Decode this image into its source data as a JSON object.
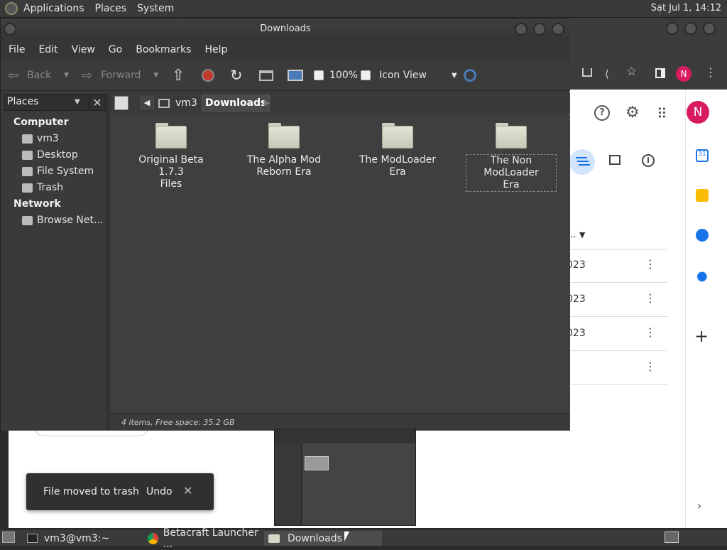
{
  "top_panel": {
    "menus": [
      "Applications",
      "Places",
      "System"
    ],
    "clock": "Sat Jul 1, 14:12"
  },
  "browser": {
    "profile_letter": "N",
    "list_rows": [
      "...",
      "023",
      "023",
      "023"
    ],
    "accent": "#1a73e8"
  },
  "window": {
    "title": "Downloads",
    "menu": [
      "File",
      "Edit",
      "View",
      "Go",
      "Bookmarks",
      "Help"
    ],
    "toolbar": {
      "back": "Back",
      "forward": "Forward",
      "zoom": "100%",
      "view_mode": "Icon View"
    },
    "sidebar": {
      "selector": "Places",
      "heading_computer": "Computer",
      "items_computer": [
        "vm3",
        "Desktop",
        "File System",
        "Trash"
      ],
      "heading_network": "Network",
      "items_network": [
        "Browse Net..."
      ]
    },
    "path": {
      "home": "vm3",
      "current": "Downloads"
    },
    "folders": [
      {
        "line1": "Original Beta 1.7.3",
        "line2": "Files"
      },
      {
        "line1": "The Alpha Mod",
        "line2": "Reborn Era"
      },
      {
        "line1": "The ModLoader Era",
        "line2": ""
      },
      {
        "line1": "The Non ModLoader",
        "line2": "Era"
      }
    ],
    "status": "4 items, Free space: 35.2 GB"
  },
  "toast": {
    "message": "File moved to trash",
    "action": "Undo"
  },
  "taskbar": {
    "items": [
      "vm3@vm3:~",
      "Betacraft Launcher ...",
      "Downloads"
    ]
  }
}
